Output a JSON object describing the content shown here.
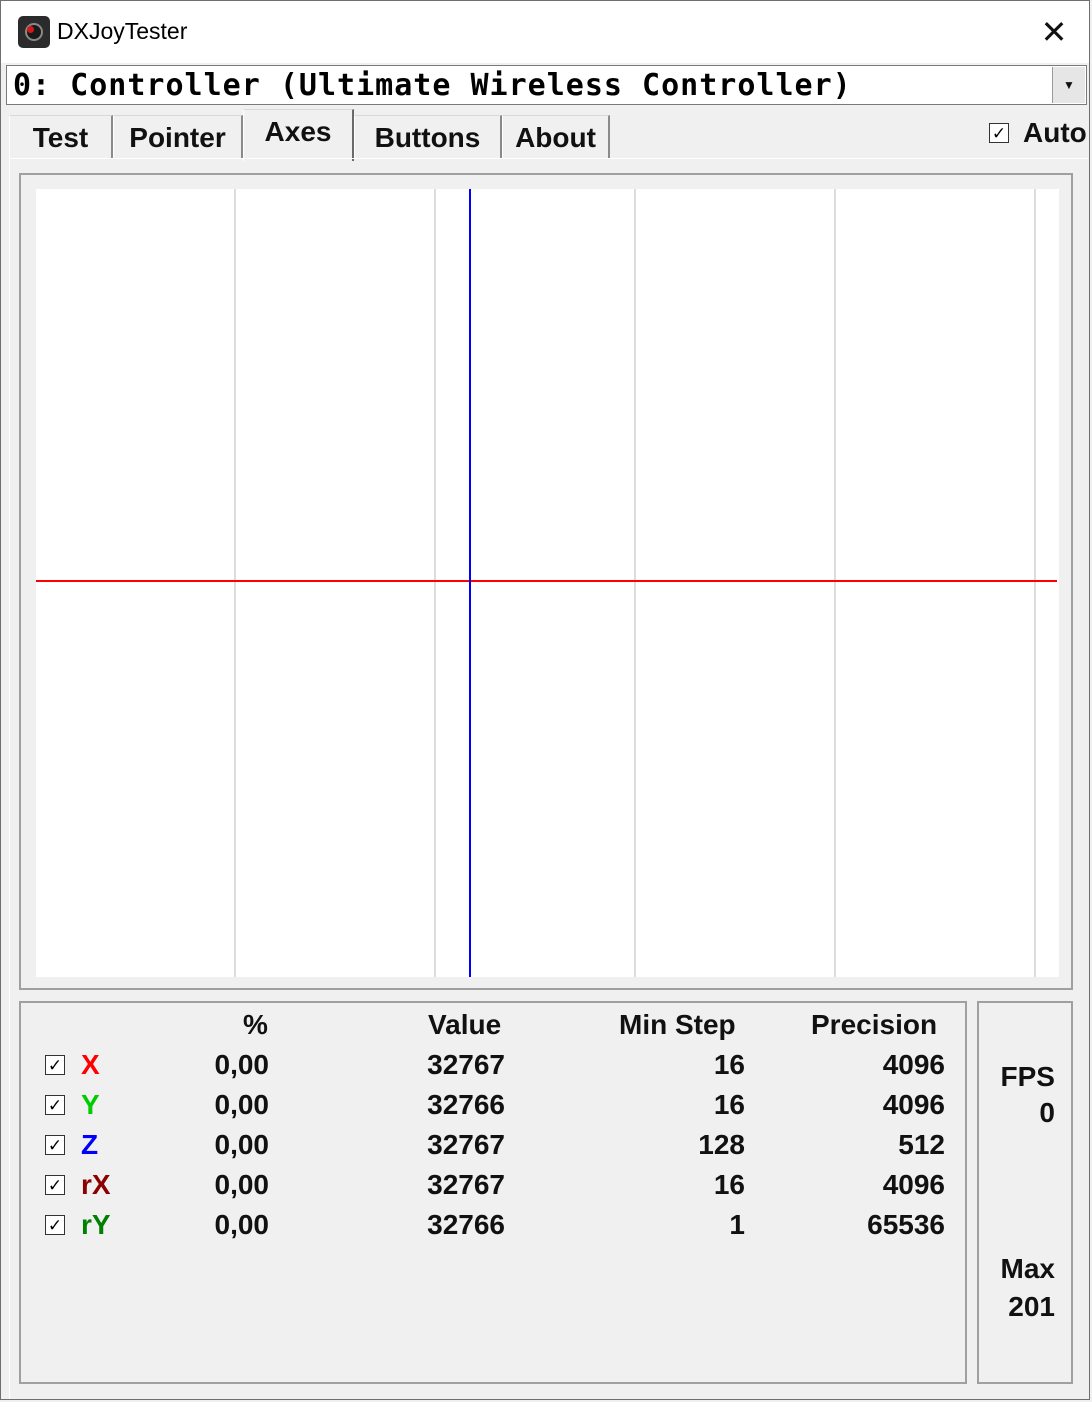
{
  "window": {
    "title": "DXJoyTester",
    "close_glyph": "✕"
  },
  "device_select": {
    "value": "0: Controller (Ultimate Wireless Controller)"
  },
  "tabs": [
    {
      "label": "Test"
    },
    {
      "label": "Pointer"
    },
    {
      "label": "Axes",
      "active": true
    },
    {
      "label": "Buttons"
    },
    {
      "label": "About"
    }
  ],
  "auto": {
    "label": "Auto",
    "checked": true
  },
  "plot": {
    "background": "#ffffff",
    "grid_color": "#dddddd",
    "x_axis_line_color": "#0000ff",
    "y_axis_line_color": "#ff0000"
  },
  "table": {
    "headers": {
      "percent": "%",
      "value": "Value",
      "min_step": "Min Step",
      "precision": "Precision"
    },
    "rows": [
      {
        "name": "X",
        "color": "#ff0000",
        "checked": true,
        "percent": "0,00",
        "value": "32767",
        "min_step": "16",
        "precision": "4096"
      },
      {
        "name": "Y",
        "color": "#00cc00",
        "checked": true,
        "percent": "0,00",
        "value": "32766",
        "min_step": "16",
        "precision": "4096"
      },
      {
        "name": "Z",
        "color": "#0000ff",
        "checked": true,
        "percent": "0,00",
        "value": "32767",
        "min_step": "128",
        "precision": "512"
      },
      {
        "name": "rX",
        "color": "#8b0000",
        "checked": true,
        "percent": "0,00",
        "value": "32767",
        "min_step": "16",
        "precision": "4096"
      },
      {
        "name": "rY",
        "color": "#008000",
        "checked": true,
        "percent": "0,00",
        "value": "32766",
        "min_step": "1",
        "precision": "65536"
      }
    ]
  },
  "fps": {
    "label": "FPS",
    "value": "0",
    "max_label": "Max",
    "max_value": "201"
  }
}
